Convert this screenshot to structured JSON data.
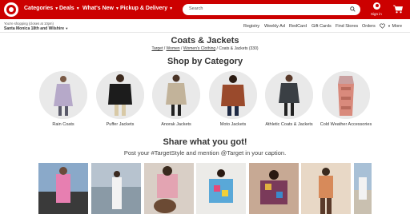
{
  "header": {
    "nav": [
      {
        "label": "Categories"
      },
      {
        "label": "Deals"
      },
      {
        "label": "What's New"
      },
      {
        "label": "Pickup & Delivery"
      }
    ],
    "search_placeholder": "Search",
    "signin_label": "Sign in"
  },
  "store": {
    "line1": "You're shopping (closes at 10pm)",
    "line2": "Santa Monica 18th and Wilshire"
  },
  "utility_links": [
    "Registry",
    "Weekly Ad",
    "RedCard",
    "Gift Cards",
    "Find Stores",
    "Orders"
  ],
  "more_label": "More",
  "page": {
    "title": "Coats & Jackets",
    "breadcrumb": {
      "links": [
        "Target",
        "Women",
        "Women's Clothing"
      ],
      "current": "Coats & Jackets (330)"
    }
  },
  "shop_by_category": {
    "title": "Shop by Category",
    "items": [
      {
        "label": "Rain Coats"
      },
      {
        "label": "Puffer Jackets"
      },
      {
        "label": "Anorak Jackets"
      },
      {
        "label": "Moto Jackets"
      },
      {
        "label": "Athletic Coats & Jackets"
      },
      {
        "label": "Cold Weather Accessories"
      }
    ]
  },
  "share": {
    "title": "Share what you got!",
    "subtitle": "Post your #TargetStyle and mention @Target in your caption."
  },
  "colors": {
    "brand_red": "#cc0000",
    "circle_bg": "#e9e9e9"
  }
}
